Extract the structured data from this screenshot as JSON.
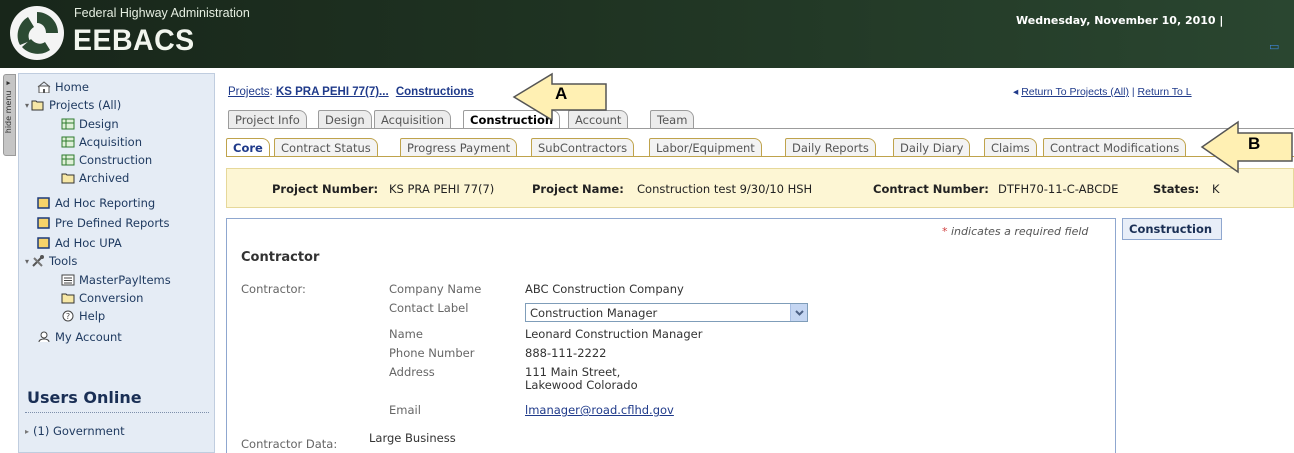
{
  "header": {
    "agency": "Federal Highway Administration",
    "app_title": "EEBACS",
    "date": "Wednesday, November 10, 2010 |",
    "colors": {
      "header_bg": "#1f3322",
      "callout_fill": "#fff0b3",
      "callout_stroke": "#555555"
    }
  },
  "hide_menu": {
    "label": "hide menu ◂"
  },
  "sidebar": {
    "items": [
      {
        "label": "Home",
        "icon": "home-icon"
      },
      {
        "label": "Projects (All)",
        "icon": "folder-open-icon"
      },
      {
        "label": "Design",
        "icon": "grid-icon"
      },
      {
        "label": "Acquisition",
        "icon": "grid-icon"
      },
      {
        "label": "Construction",
        "icon": "grid-icon"
      },
      {
        "label": "Archived",
        "icon": "folder-icon"
      },
      {
        "label": "Ad Hoc Reporting",
        "icon": "report-icon"
      },
      {
        "label": "Pre Defined Reports",
        "icon": "report-icon"
      },
      {
        "label": "Ad Hoc UPA",
        "icon": "report-icon"
      },
      {
        "label": "Tools",
        "icon": "tools-icon"
      },
      {
        "label": "MasterPayItems",
        "icon": "list-icon"
      },
      {
        "label": "Conversion",
        "icon": "folder-icon"
      },
      {
        "label": "Help",
        "icon": "help-icon"
      },
      {
        "label": "My Account",
        "icon": "account-icon"
      }
    ],
    "users_online": {
      "title": "Users Online",
      "entries": [
        {
          "label": "(1) Government"
        }
      ]
    }
  },
  "breadcrumb": {
    "root": "Projects",
    "sep": ":",
    "project": "KS PRA PEHI 77(7)...",
    "current": "Constructions"
  },
  "return_links": {
    "prefix": "◂ ",
    "link1": "Return To Projects (All)",
    "sep": " | ",
    "link2": "Return To L"
  },
  "tabs_primary": [
    {
      "label": "Project Info"
    },
    {
      "label": "Design"
    },
    {
      "label": "Acquisition"
    },
    {
      "label": "Construction"
    },
    {
      "label": "Account"
    },
    {
      "label": "Team"
    }
  ],
  "tabs_secondary": [
    {
      "label": "Core"
    },
    {
      "label": "Contract Status"
    },
    {
      "label": "Progress Payment"
    },
    {
      "label": "SubContractors"
    },
    {
      "label": "Labor/Equipment"
    },
    {
      "label": "Daily Reports"
    },
    {
      "label": "Daily Diary"
    },
    {
      "label": "Claims"
    },
    {
      "label": "Contract Modifications"
    }
  ],
  "info_bar": {
    "project_number_label": "Project Number:",
    "project_number": "KS PRA PEHI 77(7)",
    "project_name_label": "Project Name:",
    "project_name": "Construction test 9/30/10 HSH",
    "contract_number_label": "Contract Number:",
    "contract_number": "DTFH70-11-C-ABCDE",
    "states_label": "States:",
    "states_value": "K"
  },
  "form": {
    "required_star": "*",
    "required_note": " indicates a required field",
    "section_title": "Contractor",
    "contractor_label": "Contractor:",
    "fields": {
      "company_name_label": "Company Name",
      "company_name": "ABC Construction Company",
      "contact_label_label": "Contact Label",
      "contact_label_value": "Construction Manager",
      "name_label": "Name",
      "name_value": "Leonard Construction Manager",
      "phone_label": "Phone Number",
      "phone_value": "888-111-2222",
      "address_label": "Address",
      "address_line1": "111 Main Street,",
      "address_line2": "Lakewood Colorado",
      "email_label": "Email",
      "email_value": "lmanager@road.cflhd.gov"
    },
    "contractor_data_label": "Contractor Data:",
    "contractor_data_value": "Large Business"
  },
  "side_panel": {
    "title": "Construction"
  },
  "callouts": {
    "a": "A",
    "b": "B"
  }
}
